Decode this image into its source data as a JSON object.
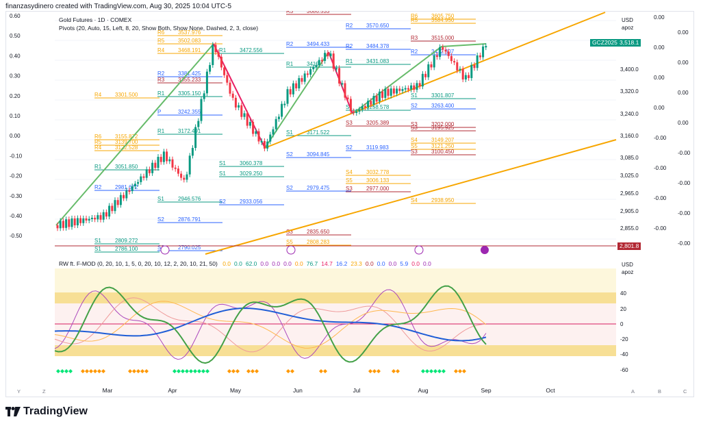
{
  "credit": "finanzasydinero created with TradingView.com, Aug 30, 2025 10:04 UTC-5",
  "legend": {
    "title": "Gold Futures · 1D · COMEX",
    "pivots": "Pivots (20, Auto, 15, Left, 8, 20, Show Both, Show None, Dashed, 2, 3, close)"
  },
  "indicator_legend": {
    "name": "RW ft. F-MOD (0, 20, 10, 1, 5, 0, 20, 10, 12, 2, 20, 10, 21, 50)",
    "values": [
      "0.0",
      "0.0",
      "62.0",
      "0.0",
      "0.0",
      "0.0",
      "0.0",
      "76.7",
      "14.7",
      "16.2",
      "23.3",
      "0.0",
      "0.0",
      "0.0",
      "5.9",
      "0.0",
      "0.0"
    ]
  },
  "price_axis": {
    "currency": "USD",
    "mode": "apoz",
    "ticks": [
      "3,400.0",
      "3,320.0",
      "3,240.0",
      "3,160.0",
      "3,085.0",
      "3,025.0",
      "2,965.0",
      "2,905.0",
      "2,855.0"
    ],
    "symbol_tag": "GCZ2025",
    "symbol_price": "3,518.1",
    "low_tag": "2,801.8"
  },
  "left_scale": [
    "0.60",
    "0.50",
    "0.40",
    "0.30",
    "0.20",
    "0.10",
    "0.00",
    "-0.10",
    "-0.20",
    "-0.30",
    "-0.40",
    "-0.50"
  ],
  "right_scale": [
    "0.00",
    "0.00",
    "0.00",
    "0.00",
    "0.00",
    "0.00",
    "0.00",
    "0.00",
    "-0.00",
    "-0.00",
    "-0.00",
    "-0.00",
    "-0.00",
    "-0.00",
    "-0.00",
    "-0.00"
  ],
  "indicator_axis": {
    "currency": "USD",
    "mode": "apoz",
    "ticks": [
      "40",
      "20",
      "0",
      "-20",
      "-40",
      "-60"
    ]
  },
  "x_axis": [
    "Mar",
    "Apr",
    "May",
    "Jun",
    "Jul",
    "Aug",
    "Sep",
    "Oct"
  ],
  "corner_left": [
    "Y",
    "Z"
  ],
  "corner_right": [
    "A",
    "B",
    "C"
  ],
  "brand": "TradingView",
  "colors": {
    "up": "#089981",
    "down": "#f23645",
    "pivot_blue": "#2962ff",
    "pivot_green": "#089981",
    "pivot_orange": "#f7a600",
    "pivot_red": "#b22833",
    "trend": "#f7a600",
    "zigzag_green": "#66bb6a",
    "zigzag_pink": "#e91e63"
  },
  "pivot_labels": [
    {
      "label": "R6",
      "value": "3537.976"
    },
    {
      "label": "R5",
      "value": "3502.083"
    },
    {
      "label": "R4",
      "value": "3468.191"
    },
    {
      "label": "R1",
      "value": "3472.556"
    },
    {
      "label": "R2",
      "value": "3381.425"
    },
    {
      "label": "R3",
      "value": "3355.233"
    },
    {
      "label": "R4",
      "value": "3301.500"
    },
    {
      "label": "R1",
      "value": "3305.150"
    },
    {
      "label": "P",
      "value": "3242.355"
    },
    {
      "label": "R1",
      "value": "3172.491"
    },
    {
      "label": "R6",
      "value": "3155.872"
    },
    {
      "label": "R5",
      "value": "3139.700"
    },
    {
      "label": "R4",
      "value": "3122.528"
    },
    {
      "label": "S1",
      "value": "3060.378"
    },
    {
      "label": "S1",
      "value": "3029.250"
    },
    {
      "label": "R1",
      "value": "3051.850"
    },
    {
      "label": "R2",
      "value": "2981.672"
    },
    {
      "label": "S1",
      "value": "2946.576"
    },
    {
      "label": "S2",
      "value": "2933.056"
    },
    {
      "label": "S2",
      "value": "2876.791"
    },
    {
      "label": "S1",
      "value": "2809.272"
    },
    {
      "label": "S1",
      "value": "2786.100"
    },
    {
      "label": "S2",
      "value": "2790.025"
    },
    {
      "label": "R3",
      "value": "3686.533"
    },
    {
      "label": "R2",
      "value": "3570.650"
    },
    {
      "label": "R2",
      "value": "3494.433"
    },
    {
      "label": "R2",
      "value": "3484.378"
    },
    {
      "label": "R1",
      "value": "3419.1"
    },
    {
      "label": "R1",
      "value": "3431.083"
    },
    {
      "label": "S1",
      "value": "3258.578"
    },
    {
      "label": "S1",
      "value": "3171.522"
    },
    {
      "label": "S2",
      "value": "3094.845"
    },
    {
      "label": "S2",
      "value": "2979.475"
    },
    {
      "label": "S3",
      "value": "2835.650"
    },
    {
      "label": "S5",
      "value": "2808.283"
    },
    {
      "label": "S2",
      "value": "3119.983"
    },
    {
      "label": "S3",
      "value": "3205.389"
    },
    {
      "label": "S4",
      "value": "3032.778"
    },
    {
      "label": "S5",
      "value": "3006.133"
    },
    {
      "label": "S3",
      "value": "2977.000"
    },
    {
      "label": "R6",
      "value": "3605.750"
    },
    {
      "label": "R5",
      "value": "3584.950"
    },
    {
      "label": "R3",
      "value": "3515.000"
    },
    {
      "label": "R2",
      "value": "3432.307"
    },
    {
      "label": "S1",
      "value": "3301.807"
    },
    {
      "label": "S2",
      "value": "3263.400"
    },
    {
      "label": "S3",
      "value": "3202.000"
    },
    {
      "label": "S3",
      "value": "3195.925"
    },
    {
      "label": "S4",
      "value": "3149.207"
    },
    {
      "label": "S5",
      "value": "3121.250"
    },
    {
      "label": "S3",
      "value": "3100.450"
    },
    {
      "label": "S4",
      "value": "2938.950"
    }
  ]
}
